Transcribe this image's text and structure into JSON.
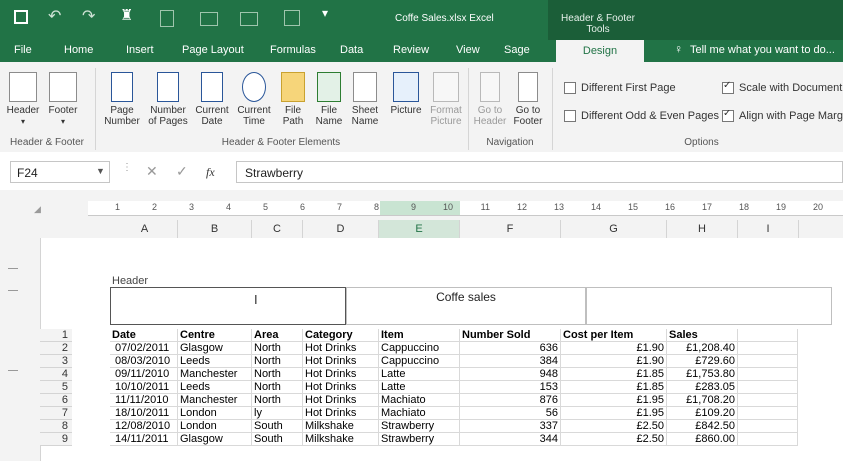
{
  "window": {
    "title": "Coffe Sales.xlsx  Excel",
    "contextual_group": "Header & Footer Tools"
  },
  "tabs": [
    "File",
    "Home",
    "Insert",
    "Page Layout",
    "Formulas",
    "Data",
    "Review",
    "View",
    "Sage"
  ],
  "active_tab": "Design",
  "tell_me": "Tell me what you want to do...",
  "ribbon": {
    "header_footer_group": {
      "label": "Header & Footer",
      "buttons": [
        "Header",
        "Footer"
      ]
    },
    "elements_group": {
      "label": "Header & Footer Elements",
      "buttons": [
        {
          "line1": "Page",
          "line2": "Number"
        },
        {
          "line1": "Number",
          "line2": "of Pages"
        },
        {
          "line1": "Current",
          "line2": "Date"
        },
        {
          "line1": "Current",
          "line2": "Time"
        },
        {
          "line1": "File",
          "line2": "Path"
        },
        {
          "line1": "File",
          "line2": "Name"
        },
        {
          "line1": "Sheet",
          "line2": "Name"
        },
        {
          "line1": "Picture",
          "line2": ""
        },
        {
          "line1": "Format",
          "line2": "Picture"
        }
      ]
    },
    "navigation_group": {
      "label": "Navigation",
      "buttons": [
        {
          "line1": "Go to",
          "line2": "Header"
        },
        {
          "line1": "Go to",
          "line2": "Footer"
        }
      ]
    },
    "options_group": {
      "label": "Options",
      "different_first_page": "Different First Page",
      "different_odd_even": "Different Odd & Even Pages",
      "scale_with_document": "Scale with Document",
      "align_with_margins": "Align with Page Margi"
    }
  },
  "formula_bar": {
    "name_box": "F24",
    "fx": "fx",
    "value": "Strawberry"
  },
  "ruler_numbers": [
    "1",
    "2",
    "3",
    "4",
    "5",
    "6",
    "7",
    "8",
    "9",
    "10",
    "11",
    "12",
    "13",
    "14",
    "15",
    "16",
    "17",
    "18",
    "19",
    "20"
  ],
  "columns": [
    "A",
    "B",
    "C",
    "D",
    "E",
    "F",
    "G",
    "H",
    "I"
  ],
  "selected_column": "E",
  "page_header": {
    "label": "Header",
    "center_text": "Coffe sales"
  },
  "row_numbers": [
    "1",
    "2",
    "3",
    "4",
    "5",
    "6",
    "7",
    "8",
    "9"
  ],
  "table": {
    "headers": [
      "Date",
      "Centre",
      "Area",
      "Category",
      "Item",
      "Number Sold",
      "Cost per Item",
      "Sales"
    ],
    "rows": [
      [
        "07/02/2011",
        "Glasgow",
        "North",
        "Hot Drinks",
        "Cappuccino",
        "636",
        "£1.90",
        "£1,208.40"
      ],
      [
        "08/03/2010",
        "Leeds",
        "North",
        "Hot Drinks",
        "Cappuccino",
        "384",
        "£1.90",
        "£729.60"
      ],
      [
        "09/11/2010",
        "Manchester",
        "North",
        "Hot Drinks",
        "Latte",
        "948",
        "£1.85",
        "£1,753.80"
      ],
      [
        "10/10/2011",
        "Leeds",
        "North",
        "Hot Drinks",
        "Latte",
        "153",
        "£1.85",
        "£283.05"
      ],
      [
        "11/11/2010",
        "Manchester",
        "North",
        "Hot Drinks",
        "Machiato",
        "876",
        "£1.95",
        "£1,708.20"
      ],
      [
        "18/10/2011",
        "London",
        "ly",
        "Hot Drinks",
        "Machiato",
        "56",
        "£1.95",
        "£109.20"
      ],
      [
        "12/08/2010",
        "London",
        "South",
        "Milkshake",
        "Strawberry",
        "337",
        "£2.50",
        "£842.50"
      ],
      [
        "14/11/2011",
        "Glasgow",
        "South",
        "Milkshake",
        "Strawberry",
        "344",
        "£2.50",
        "£860.00"
      ]
    ]
  }
}
